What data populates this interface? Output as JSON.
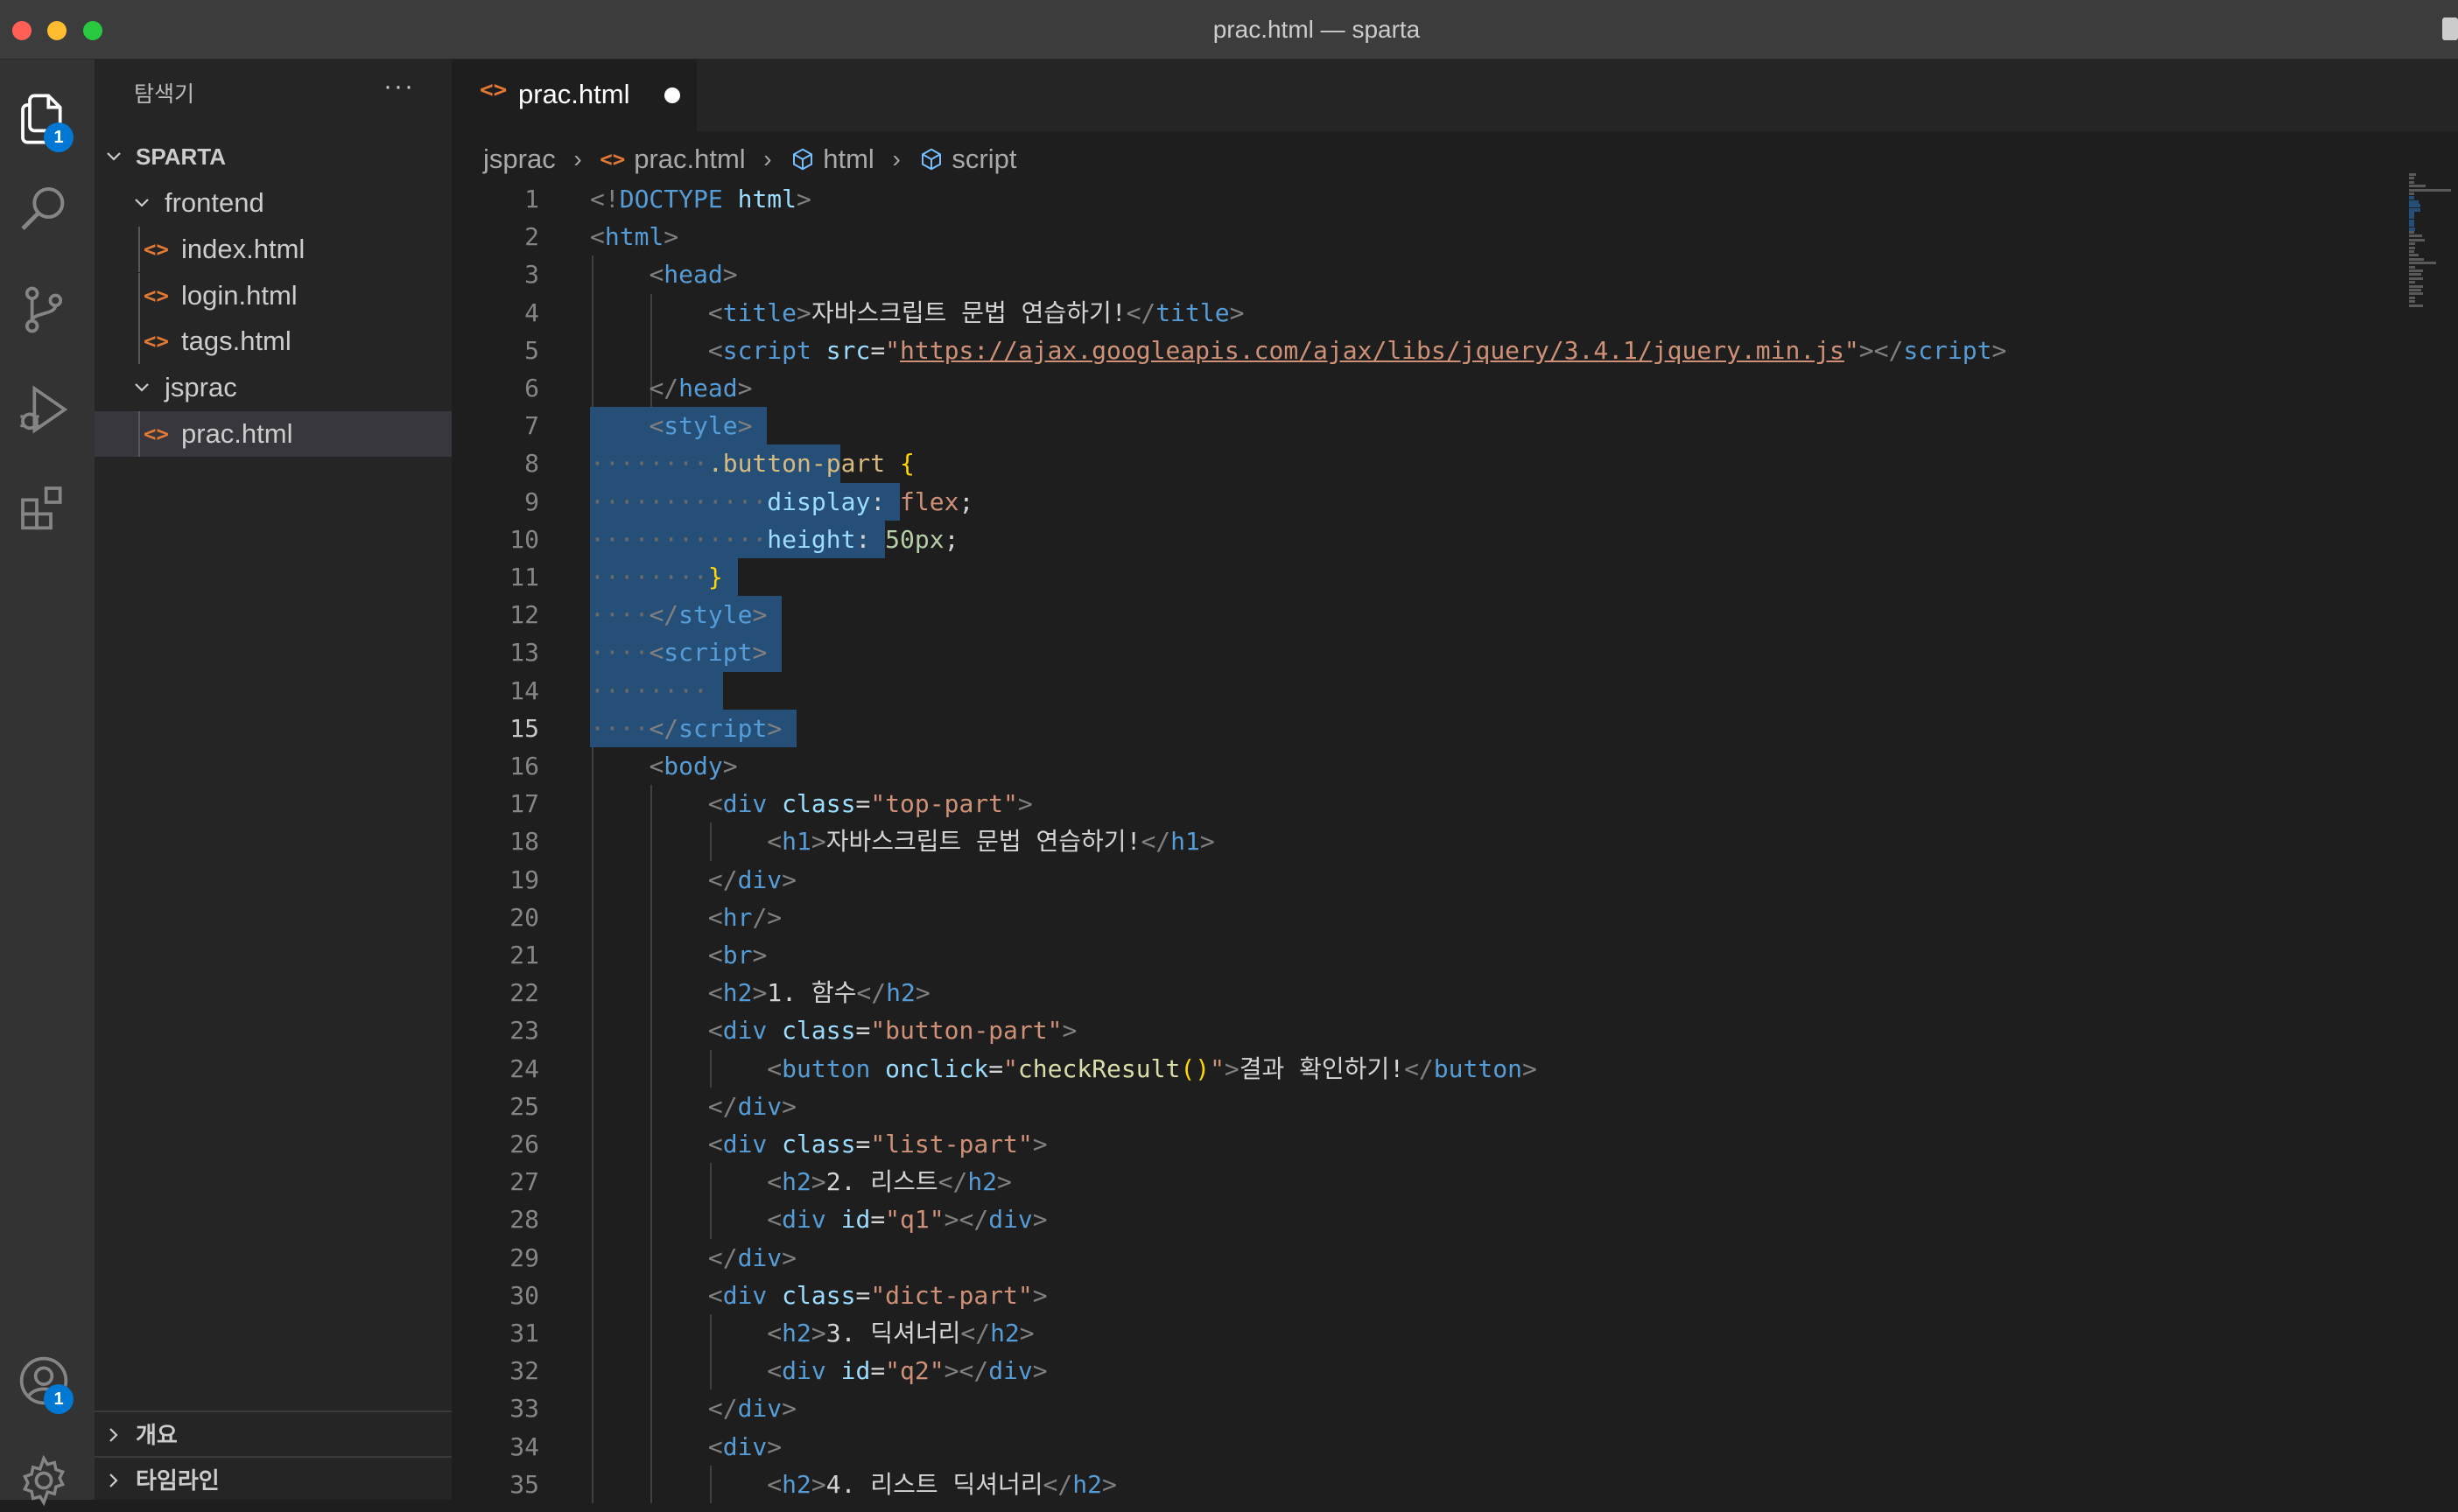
{
  "window": {
    "title": "prac.html — sparta"
  },
  "activity_bar": {
    "explorer_badge": "1",
    "accounts_badge": "1"
  },
  "sidebar": {
    "title": "탐색기",
    "more": "···",
    "root": "SPARTA",
    "tree": [
      {
        "label": "frontend",
        "type": "folder",
        "depth": 1
      },
      {
        "label": "index.html",
        "type": "file",
        "depth": 2
      },
      {
        "label": "login.html",
        "type": "file",
        "depth": 2
      },
      {
        "label": "tags.html",
        "type": "file",
        "depth": 2
      },
      {
        "label": "jsprac",
        "type": "folder",
        "depth": 1
      },
      {
        "label": "prac.html",
        "type": "file",
        "depth": 2,
        "selected": true
      }
    ],
    "sections": [
      "개요",
      "타임라인"
    ]
  },
  "editor": {
    "tab": {
      "label": "prac.html",
      "modified": true
    },
    "breadcrumb": [
      "jsprac",
      "prac.html",
      "html",
      "script"
    ],
    "current_line": 15,
    "lines": [
      [
        [
          "p",
          "<!"
        ],
        [
          "t",
          "DOCTYPE"
        ],
        [
          "x",
          " "
        ],
        [
          "a",
          "html"
        ],
        [
          "p",
          ">"
        ]
      ],
      [
        [
          "p",
          "<"
        ],
        [
          "t",
          "html"
        ],
        [
          "p",
          ">"
        ]
      ],
      [
        [
          "x",
          "    "
        ],
        [
          "p",
          "<"
        ],
        [
          "t",
          "head"
        ],
        [
          "p",
          ">"
        ]
      ],
      [
        [
          "x",
          "        "
        ],
        [
          "p",
          "<"
        ],
        [
          "t",
          "title"
        ],
        [
          "p",
          ">"
        ],
        [
          "x",
          "자바스크립트 문법 연습하기!"
        ],
        [
          "p",
          "</"
        ],
        [
          "t",
          "title"
        ],
        [
          "p",
          ">"
        ]
      ],
      [
        [
          "x",
          "        "
        ],
        [
          "p",
          "<"
        ],
        [
          "t",
          "script"
        ],
        [
          "x",
          " "
        ],
        [
          "a",
          "src"
        ],
        [
          "x",
          "="
        ],
        [
          "s",
          "\""
        ],
        [
          "u",
          "https://ajax.googleapis.com/ajax/libs/jquery/3.4.1/jquery.min.js"
        ],
        [
          "s",
          "\""
        ],
        [
          "p",
          "></"
        ],
        [
          "t",
          "script"
        ],
        [
          "p",
          ">"
        ]
      ],
      [
        [
          "x",
          "    "
        ],
        [
          "p",
          "</"
        ],
        [
          "t",
          "head"
        ],
        [
          "p",
          ">"
        ]
      ],
      [
        [
          "x",
          "    "
        ],
        [
          "p",
          "<"
        ],
        [
          "t",
          "style"
        ],
        [
          "p",
          ">"
        ]
      ],
      [
        [
          "d",
          "········"
        ],
        [
          "c",
          ".button-part"
        ],
        [
          "x",
          " "
        ],
        [
          "b",
          "{"
        ]
      ],
      [
        [
          "d",
          "············"
        ],
        [
          "a",
          "display"
        ],
        [
          "x",
          ": "
        ],
        [
          "s",
          "flex"
        ],
        [
          "x",
          ";"
        ]
      ],
      [
        [
          "d",
          "············"
        ],
        [
          "a",
          "height"
        ],
        [
          "x",
          ": "
        ],
        [
          "n",
          "50px"
        ],
        [
          "x",
          ";"
        ]
      ],
      [
        [
          "d",
          "········"
        ],
        [
          "b",
          "}"
        ]
      ],
      [
        [
          "d",
          "····"
        ],
        [
          "p",
          "</"
        ],
        [
          "t",
          "style"
        ],
        [
          "p",
          ">"
        ]
      ],
      [
        [
          "d",
          "····"
        ],
        [
          "p",
          "<"
        ],
        [
          "t",
          "script"
        ],
        [
          "p",
          ">"
        ]
      ],
      [
        [
          "d",
          "········"
        ]
      ],
      [
        [
          "d",
          "····"
        ],
        [
          "p",
          "</"
        ],
        [
          "t",
          "script"
        ],
        [
          "p",
          ">"
        ]
      ],
      [
        [
          "x",
          "    "
        ],
        [
          "p",
          "<"
        ],
        [
          "t",
          "body"
        ],
        [
          "p",
          ">"
        ]
      ],
      [
        [
          "x",
          "        "
        ],
        [
          "p",
          "<"
        ],
        [
          "t",
          "div"
        ],
        [
          "x",
          " "
        ],
        [
          "a",
          "class"
        ],
        [
          "x",
          "="
        ],
        [
          "s",
          "\"top-part\""
        ],
        [
          "p",
          ">"
        ]
      ],
      [
        [
          "x",
          "            "
        ],
        [
          "p",
          "<"
        ],
        [
          "t",
          "h1"
        ],
        [
          "p",
          ">"
        ],
        [
          "x",
          "자바스크립트 문법 연습하기!"
        ],
        [
          "p",
          "</"
        ],
        [
          "t",
          "h1"
        ],
        [
          "p",
          ">"
        ]
      ],
      [
        [
          "x",
          "        "
        ],
        [
          "p",
          "</"
        ],
        [
          "t",
          "div"
        ],
        [
          "p",
          ">"
        ]
      ],
      [
        [
          "x",
          "        "
        ],
        [
          "p",
          "<"
        ],
        [
          "t",
          "hr"
        ],
        [
          "p",
          "/>"
        ]
      ],
      [
        [
          "x",
          "        "
        ],
        [
          "p",
          "<"
        ],
        [
          "t",
          "br"
        ],
        [
          "p",
          ">"
        ]
      ],
      [
        [
          "x",
          "        "
        ],
        [
          "p",
          "<"
        ],
        [
          "t",
          "h2"
        ],
        [
          "p",
          ">"
        ],
        [
          "x",
          "1. 함수"
        ],
        [
          "p",
          "</"
        ],
        [
          "t",
          "h2"
        ],
        [
          "p",
          ">"
        ]
      ],
      [
        [
          "x",
          "        "
        ],
        [
          "p",
          "<"
        ],
        [
          "t",
          "div"
        ],
        [
          "x",
          " "
        ],
        [
          "a",
          "class"
        ],
        [
          "x",
          "="
        ],
        [
          "s",
          "\"button-part\""
        ],
        [
          "p",
          ">"
        ]
      ],
      [
        [
          "x",
          "            "
        ],
        [
          "p",
          "<"
        ],
        [
          "t",
          "button"
        ],
        [
          "x",
          " "
        ],
        [
          "a",
          "onclick"
        ],
        [
          "x",
          "="
        ],
        [
          "s",
          "\""
        ],
        [
          "f",
          "checkResult"
        ],
        [
          "b",
          "()"
        ],
        [
          "s",
          "\""
        ],
        [
          "p",
          ">"
        ],
        [
          "x",
          "결과 확인하기!"
        ],
        [
          "p",
          "</"
        ],
        [
          "t",
          "button"
        ],
        [
          "p",
          ">"
        ]
      ],
      [
        [
          "x",
          "        "
        ],
        [
          "p",
          "</"
        ],
        [
          "t",
          "div"
        ],
        [
          "p",
          ">"
        ]
      ],
      [
        [
          "x",
          "        "
        ],
        [
          "p",
          "<"
        ],
        [
          "t",
          "div"
        ],
        [
          "x",
          " "
        ],
        [
          "a",
          "class"
        ],
        [
          "x",
          "="
        ],
        [
          "s",
          "\"list-part\""
        ],
        [
          "p",
          ">"
        ]
      ],
      [
        [
          "x",
          "            "
        ],
        [
          "p",
          "<"
        ],
        [
          "t",
          "h2"
        ],
        [
          "p",
          ">"
        ],
        [
          "x",
          "2. 리스트"
        ],
        [
          "p",
          "</"
        ],
        [
          "t",
          "h2"
        ],
        [
          "p",
          ">"
        ]
      ],
      [
        [
          "x",
          "            "
        ],
        [
          "p",
          "<"
        ],
        [
          "t",
          "div"
        ],
        [
          "x",
          " "
        ],
        [
          "a",
          "id"
        ],
        [
          "x",
          "="
        ],
        [
          "s",
          "\"q1\""
        ],
        [
          "p",
          "></"
        ],
        [
          "t",
          "div"
        ],
        [
          "p",
          ">"
        ]
      ],
      [
        [
          "x",
          "        "
        ],
        [
          "p",
          "</"
        ],
        [
          "t",
          "div"
        ],
        [
          "p",
          ">"
        ]
      ],
      [
        [
          "x",
          "        "
        ],
        [
          "p",
          "<"
        ],
        [
          "t",
          "div"
        ],
        [
          "x",
          " "
        ],
        [
          "a",
          "class"
        ],
        [
          "x",
          "="
        ],
        [
          "s",
          "\"dict-part\""
        ],
        [
          "p",
          ">"
        ]
      ],
      [
        [
          "x",
          "            "
        ],
        [
          "p",
          "<"
        ],
        [
          "t",
          "h2"
        ],
        [
          "p",
          ">"
        ],
        [
          "x",
          "3. 딕셔너리"
        ],
        [
          "p",
          "</"
        ],
        [
          "t",
          "h2"
        ],
        [
          "p",
          ">"
        ]
      ],
      [
        [
          "x",
          "            "
        ],
        [
          "p",
          "<"
        ],
        [
          "t",
          "div"
        ],
        [
          "x",
          " "
        ],
        [
          "a",
          "id"
        ],
        [
          "x",
          "="
        ],
        [
          "s",
          "\"q2\""
        ],
        [
          "p",
          "></"
        ],
        [
          "t",
          "div"
        ],
        [
          "p",
          ">"
        ]
      ],
      [
        [
          "x",
          "        "
        ],
        [
          "p",
          "</"
        ],
        [
          "t",
          "div"
        ],
        [
          "p",
          ">"
        ]
      ],
      [
        [
          "x",
          "        "
        ],
        [
          "p",
          "<"
        ],
        [
          "t",
          "div"
        ],
        [
          "p",
          ">"
        ]
      ],
      [
        [
          "x",
          "            "
        ],
        [
          "p",
          "<"
        ],
        [
          "t",
          "h2"
        ],
        [
          "p",
          ">"
        ],
        [
          "x",
          "4. 리스트 딕셔너리"
        ],
        [
          "p",
          "</"
        ],
        [
          "t",
          "h2"
        ],
        [
          "p",
          ">"
        ]
      ]
    ]
  },
  "colors": {
    "selection": "#264f78",
    "tag": "#569cd6",
    "attribute": "#9cdcfe",
    "string": "#ce9178",
    "file_icon": "#e37933",
    "badge": "#0078d4"
  }
}
